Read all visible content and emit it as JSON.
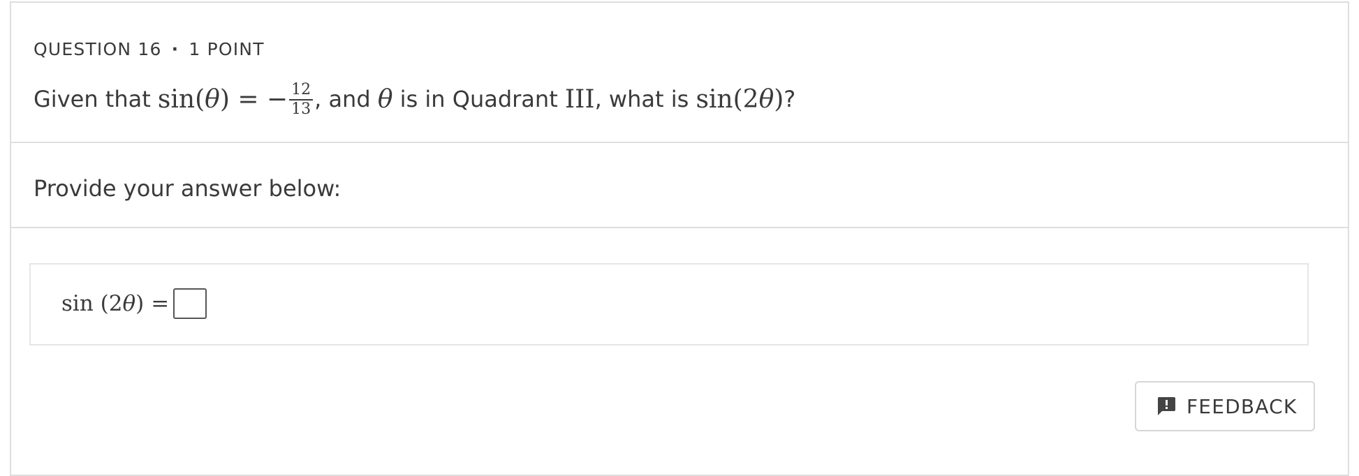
{
  "question": {
    "number_label": "QUESTION 16",
    "separator": "·",
    "points_label": "1 POINT",
    "text_given_that": "Given that",
    "math_sin_theta": "sin(",
    "math_theta": "θ",
    "math_close_eq": ") = −",
    "fraction_numerator": "12",
    "fraction_denominator": "13",
    "text_and": ", and",
    "text_is_in_quadrant": "is in Quadrant",
    "math_quadrant_roman": "III",
    "text_what_is": ", what is",
    "math_sin_2theta_open": "sin(2",
    "math_sin_2theta_close": ")",
    "text_question_mark": "?"
  },
  "prompt": {
    "label": "Provide your answer below:"
  },
  "answer": {
    "lhs_func": "sin",
    "lhs_arg_open": "(2",
    "lhs_theta": "θ",
    "lhs_arg_close": ")",
    "equals": "=",
    "input_value": ""
  },
  "feedback": {
    "label": "FEEDBACK",
    "icon": "feedback-icon"
  },
  "colors": {
    "text": "#3a3a3a",
    "border": "#dedede",
    "background": "#ffffff"
  }
}
